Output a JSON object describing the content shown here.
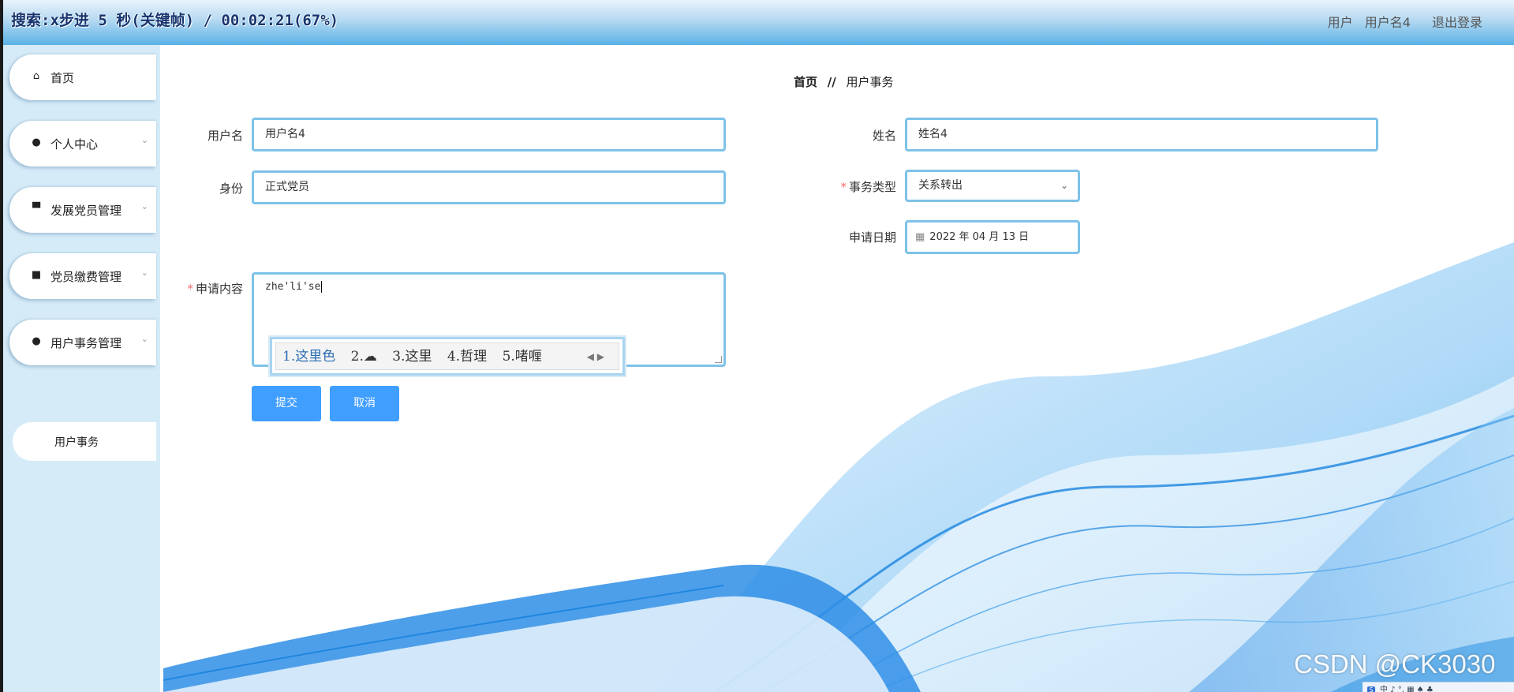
{
  "window": {
    "title": "搜索:x步进 5 秒(关键帧) / 00:02:21(67%)"
  },
  "header": {
    "user_prefix": "用户",
    "username": "用户名4",
    "logout": "退出登录"
  },
  "sidebar": {
    "items": [
      {
        "label": "首页",
        "icon": "home-icon",
        "expandable": false
      },
      {
        "label": "个人中心",
        "icon": "user-icon",
        "expandable": true
      },
      {
        "label": "发展党员管理",
        "icon": "stamp-icon",
        "expandable": true
      },
      {
        "label": "党员缴费管理",
        "icon": "wallet-icon",
        "expandable": true
      },
      {
        "label": "用户事务管理",
        "icon": "user-icon",
        "expandable": true
      }
    ],
    "sub_item": {
      "label": "用户事务"
    }
  },
  "breadcrumb": {
    "home": "首页",
    "separator": "//",
    "current": "用户事务"
  },
  "form": {
    "username": {
      "label": "用户名",
      "value": "用户名4"
    },
    "realname": {
      "label": "姓名",
      "value": "姓名4"
    },
    "identity": {
      "label": "身份",
      "value": "正式党员"
    },
    "affair_type": {
      "label": "事务类型",
      "value": "关系转出",
      "required": true
    },
    "apply_date": {
      "label": "申请日期",
      "value": "2022 年 04 月 13 日"
    },
    "content": {
      "label": "申请内容",
      "value": "zhe'li'se",
      "required": true
    },
    "submit": "提交",
    "cancel": "取消"
  },
  "ime": {
    "candidates": [
      "1.这里色",
      "2.",
      "3.这里",
      "4.哲理",
      "5.啫喱"
    ],
    "cloud_icon": "cloud-icon"
  },
  "watermark": "CSDN @CK3030",
  "tray": {
    "text": "中 ♪ °, ▦ ♠ ♣"
  },
  "colors": {
    "accent": "#409eff",
    "input_border": "#7ec2e8",
    "sidebar_bg": "#d6ebf8",
    "required": "#f56c6c"
  }
}
